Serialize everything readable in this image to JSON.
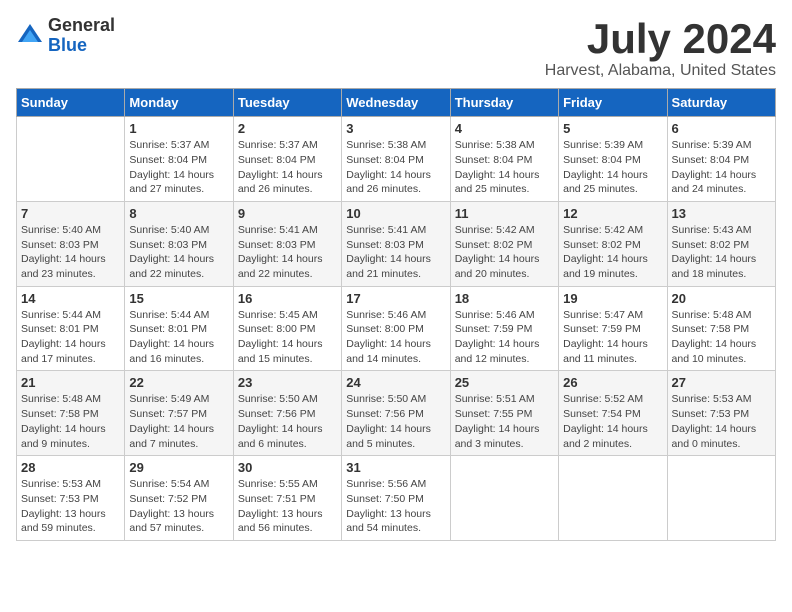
{
  "logo": {
    "general": "General",
    "blue": "Blue"
  },
  "title": "July 2024",
  "subtitle": "Harvest, Alabama, United States",
  "headers": [
    "Sunday",
    "Monday",
    "Tuesday",
    "Wednesday",
    "Thursday",
    "Friday",
    "Saturday"
  ],
  "weeks": [
    [
      {
        "day": "",
        "info": ""
      },
      {
        "day": "1",
        "info": "Sunrise: 5:37 AM\nSunset: 8:04 PM\nDaylight: 14 hours\nand 27 minutes."
      },
      {
        "day": "2",
        "info": "Sunrise: 5:37 AM\nSunset: 8:04 PM\nDaylight: 14 hours\nand 26 minutes."
      },
      {
        "day": "3",
        "info": "Sunrise: 5:38 AM\nSunset: 8:04 PM\nDaylight: 14 hours\nand 26 minutes."
      },
      {
        "day": "4",
        "info": "Sunrise: 5:38 AM\nSunset: 8:04 PM\nDaylight: 14 hours\nand 25 minutes."
      },
      {
        "day": "5",
        "info": "Sunrise: 5:39 AM\nSunset: 8:04 PM\nDaylight: 14 hours\nand 25 minutes."
      },
      {
        "day": "6",
        "info": "Sunrise: 5:39 AM\nSunset: 8:04 PM\nDaylight: 14 hours\nand 24 minutes."
      }
    ],
    [
      {
        "day": "7",
        "info": "Sunrise: 5:40 AM\nSunset: 8:03 PM\nDaylight: 14 hours\nand 23 minutes."
      },
      {
        "day": "8",
        "info": "Sunrise: 5:40 AM\nSunset: 8:03 PM\nDaylight: 14 hours\nand 22 minutes."
      },
      {
        "day": "9",
        "info": "Sunrise: 5:41 AM\nSunset: 8:03 PM\nDaylight: 14 hours\nand 22 minutes."
      },
      {
        "day": "10",
        "info": "Sunrise: 5:41 AM\nSunset: 8:03 PM\nDaylight: 14 hours\nand 21 minutes."
      },
      {
        "day": "11",
        "info": "Sunrise: 5:42 AM\nSunset: 8:02 PM\nDaylight: 14 hours\nand 20 minutes."
      },
      {
        "day": "12",
        "info": "Sunrise: 5:42 AM\nSunset: 8:02 PM\nDaylight: 14 hours\nand 19 minutes."
      },
      {
        "day": "13",
        "info": "Sunrise: 5:43 AM\nSunset: 8:02 PM\nDaylight: 14 hours\nand 18 minutes."
      }
    ],
    [
      {
        "day": "14",
        "info": "Sunrise: 5:44 AM\nSunset: 8:01 PM\nDaylight: 14 hours\nand 17 minutes."
      },
      {
        "day": "15",
        "info": "Sunrise: 5:44 AM\nSunset: 8:01 PM\nDaylight: 14 hours\nand 16 minutes."
      },
      {
        "day": "16",
        "info": "Sunrise: 5:45 AM\nSunset: 8:00 PM\nDaylight: 14 hours\nand 15 minutes."
      },
      {
        "day": "17",
        "info": "Sunrise: 5:46 AM\nSunset: 8:00 PM\nDaylight: 14 hours\nand 14 minutes."
      },
      {
        "day": "18",
        "info": "Sunrise: 5:46 AM\nSunset: 7:59 PM\nDaylight: 14 hours\nand 12 minutes."
      },
      {
        "day": "19",
        "info": "Sunrise: 5:47 AM\nSunset: 7:59 PM\nDaylight: 14 hours\nand 11 minutes."
      },
      {
        "day": "20",
        "info": "Sunrise: 5:48 AM\nSunset: 7:58 PM\nDaylight: 14 hours\nand 10 minutes."
      }
    ],
    [
      {
        "day": "21",
        "info": "Sunrise: 5:48 AM\nSunset: 7:58 PM\nDaylight: 14 hours\nand 9 minutes."
      },
      {
        "day": "22",
        "info": "Sunrise: 5:49 AM\nSunset: 7:57 PM\nDaylight: 14 hours\nand 7 minutes."
      },
      {
        "day": "23",
        "info": "Sunrise: 5:50 AM\nSunset: 7:56 PM\nDaylight: 14 hours\nand 6 minutes."
      },
      {
        "day": "24",
        "info": "Sunrise: 5:50 AM\nSunset: 7:56 PM\nDaylight: 14 hours\nand 5 minutes."
      },
      {
        "day": "25",
        "info": "Sunrise: 5:51 AM\nSunset: 7:55 PM\nDaylight: 14 hours\nand 3 minutes."
      },
      {
        "day": "26",
        "info": "Sunrise: 5:52 AM\nSunset: 7:54 PM\nDaylight: 14 hours\nand 2 minutes."
      },
      {
        "day": "27",
        "info": "Sunrise: 5:53 AM\nSunset: 7:53 PM\nDaylight: 14 hours\nand 0 minutes."
      }
    ],
    [
      {
        "day": "28",
        "info": "Sunrise: 5:53 AM\nSunset: 7:53 PM\nDaylight: 13 hours\nand 59 minutes."
      },
      {
        "day": "29",
        "info": "Sunrise: 5:54 AM\nSunset: 7:52 PM\nDaylight: 13 hours\nand 57 minutes."
      },
      {
        "day": "30",
        "info": "Sunrise: 5:55 AM\nSunset: 7:51 PM\nDaylight: 13 hours\nand 56 minutes."
      },
      {
        "day": "31",
        "info": "Sunrise: 5:56 AM\nSunset: 7:50 PM\nDaylight: 13 hours\nand 54 minutes."
      },
      {
        "day": "",
        "info": ""
      },
      {
        "day": "",
        "info": ""
      },
      {
        "day": "",
        "info": ""
      }
    ]
  ]
}
